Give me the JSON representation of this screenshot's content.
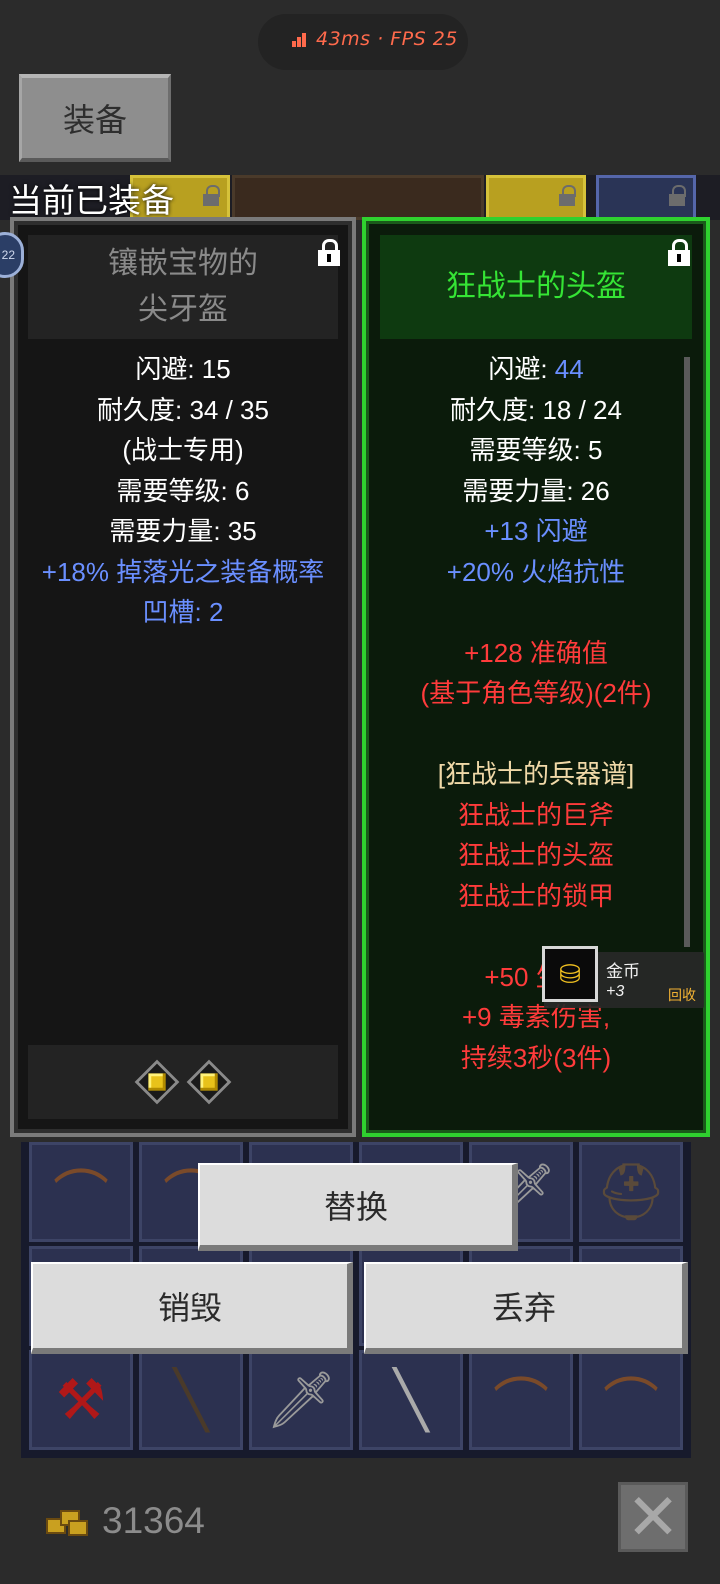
{
  "status_bar": {
    "network_text": "43ms · FPS 25"
  },
  "tabs": {
    "equip_label": "装备"
  },
  "section": {
    "equipped_label": "当前已装备",
    "side_badge": "22"
  },
  "left_item": {
    "name_line1": "镶嵌宝物的",
    "name_line2": "尖牙盔",
    "stats": [
      {
        "text": "闪避: 15",
        "color": "white"
      },
      {
        "text": "耐久度: 34 / 35",
        "color": "white"
      },
      {
        "text": "(战士专用)",
        "color": "white"
      },
      {
        "text": "需要等级: 6",
        "color": "white"
      },
      {
        "text": "需要力量: 35",
        "color": "white"
      },
      {
        "text": "+18% 掉落光之装备概率",
        "color": "blue"
      },
      {
        "text": "凹槽: 2",
        "color": "blue"
      }
    ],
    "sockets": 2
  },
  "right_item": {
    "name": "狂战士的头盔",
    "stats": [
      {
        "label": "闪避: ",
        "value": "44"
      },
      {
        "text": "耐久度: 18 / 24",
        "color": "white"
      },
      {
        "text": "需要等级: 5",
        "color": "white"
      },
      {
        "text": "需要力量: 26",
        "color": "white"
      },
      {
        "text": "+13 闪避",
        "color": "blue"
      },
      {
        "text": "+20% 火焰抗性",
        "color": "blue"
      },
      {
        "text": "",
        "color": "white"
      },
      {
        "text": "+128 准确值",
        "color": "red"
      },
      {
        "text": "(基于角色等级)(2件)",
        "color": "red"
      },
      {
        "text": "",
        "color": "white"
      },
      {
        "text": "[狂战士的兵器谱]",
        "color": "gold"
      },
      {
        "text": "狂战士的巨斧",
        "color": "red"
      },
      {
        "text": "狂战士的头盔",
        "color": "red"
      },
      {
        "text": "狂战士的锁甲",
        "color": "red"
      },
      {
        "text": "",
        "color": "white"
      },
      {
        "text": "+50 生命",
        "color": "red"
      },
      {
        "text": "+9 毒素伤害,",
        "color": "red"
      },
      {
        "text": "持续3秒(3件)",
        "color": "red"
      }
    ]
  },
  "toast": {
    "name": "金币",
    "amount": "+3",
    "recycle": "回收"
  },
  "actions": {
    "replace": "替换",
    "destroy": "销毁",
    "discard": "丢弃"
  },
  "footer": {
    "gold_amount": "31364"
  },
  "colors": {
    "white": "#ffffff",
    "blue": "#6a8fff",
    "red": "#ff3b3b",
    "gold": "#f0d9a8",
    "green_title": "#35e435"
  },
  "inventory_items": [
    "bow-icon",
    "bow-icon",
    "helmet-icon",
    "bow-icon",
    "sword-icon",
    "helmet-icon",
    "axe-icon",
    "club-icon",
    "sword-icon",
    "dagger-icon",
    "bow-icon",
    "bow-icon"
  ]
}
